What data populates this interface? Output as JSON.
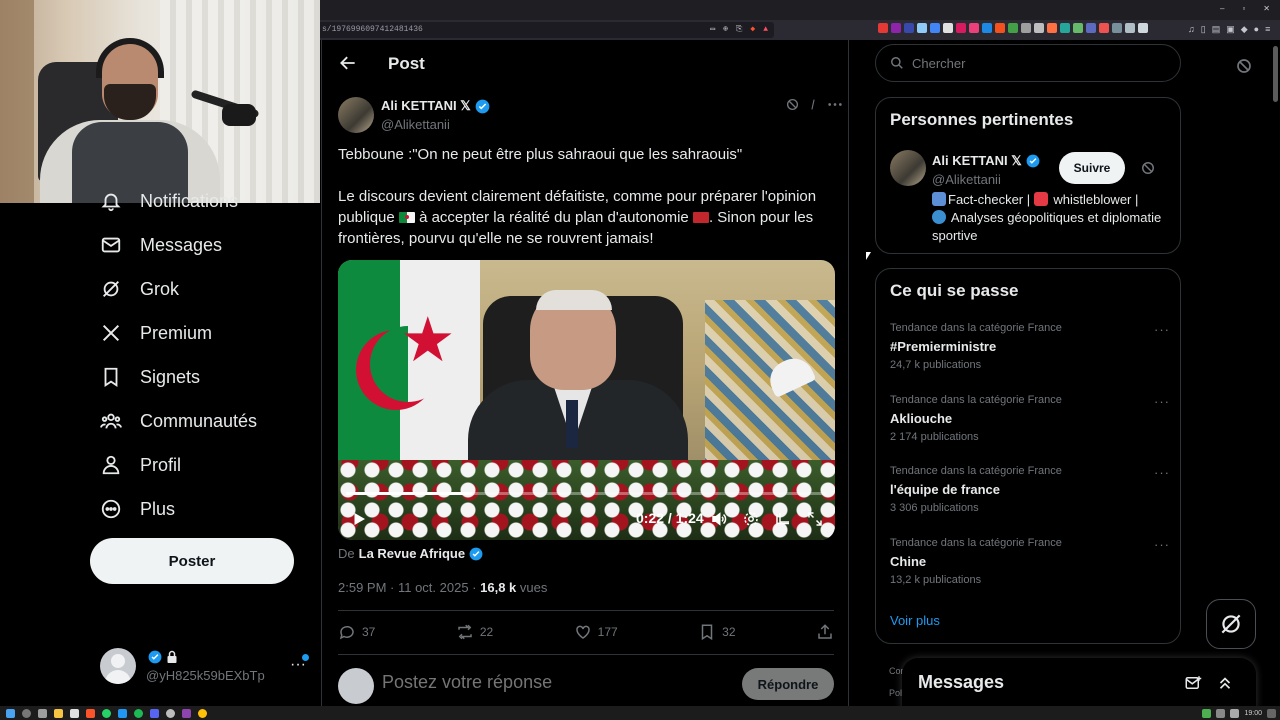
{
  "browser": {
    "url": "s/1976996097412481436",
    "window_controls": [
      "–",
      "▫",
      "✕"
    ]
  },
  "nav": {
    "items": [
      {
        "label": "Notifications",
        "icon": "bell-icon"
      },
      {
        "label": "Messages",
        "icon": "mail-icon"
      },
      {
        "label": "Grok",
        "icon": "grok-icon"
      },
      {
        "label": "Premium",
        "icon": "x-logo-icon"
      },
      {
        "label": "Signets",
        "icon": "bookmark-icon"
      },
      {
        "label": "Communautés",
        "icon": "people-icon"
      },
      {
        "label": "Profil",
        "icon": "user-icon"
      },
      {
        "label": "Plus",
        "icon": "more-circle-icon"
      }
    ],
    "post_button": "Poster",
    "account_handle": "@yH825k59bEXbTp",
    "account_more": "···"
  },
  "post": {
    "header_title": "Post",
    "author_name": "Ali KETTANI 𝕏",
    "author_handle": "@Alikettanii",
    "text_line1": "Tebboune :\"On ne peut être plus sahraoui que les sahraouis\"",
    "text_p2_a": "Le discours devient clairement défaitiste, comme pour préparer l'opinion publique",
    "text_p2_b": "à accepter la réalité du plan d'autonomie",
    "text_p2_c": ". Sinon pour les frontières, pourvu qu'elle ne se rouvrent jamais!",
    "video_time": "0:22 / 1:24",
    "video_progress": 0.262,
    "source_prefix": "De",
    "source_name": "La Revue Afrique",
    "time": "2:59 PM · 11 oct. 2025 · ",
    "views_count": "16,8 k",
    "views_label": " vues",
    "stats": {
      "replies": "37",
      "reposts": "22",
      "likes": "177",
      "bookmarks": "32"
    },
    "reply_placeholder": "Postez votre réponse",
    "reply_button": "Répondre"
  },
  "right": {
    "search_placeholder": "Chercher",
    "people_title": "Personnes pertinentes",
    "person": {
      "name": "Ali KETTANI 𝕏",
      "handle": "@Alikettanii",
      "follow": "Suivre",
      "bio_1": "Fact-checker | ",
      "bio_2": " whistleblower |",
      "bio_3": " Analyses géopolitiques et diplomatie sportive"
    },
    "trends_title": "Ce qui se passe",
    "trends": [
      {
        "category": "Tendance dans la catégorie France",
        "name": "#Premierministre",
        "count": "24,7 k publications"
      },
      {
        "category": "Tendance dans la catégorie France",
        "name": "Akliouche",
        "count": "2 174 publications"
      },
      {
        "category": "Tendance dans la catégorie France",
        "name": "l'équipe de france",
        "count": "3 306 publications"
      },
      {
        "category": "Tendance dans la catégorie France",
        "name": "Chine",
        "count": "13,2 k publications"
      }
    ],
    "see_more": "Voir plus",
    "messages_title": "Messages",
    "footer_1": "Con",
    "footer_2": "Poli"
  },
  "colors": {
    "accent": "#1d9bf0",
    "background": "#000000",
    "border": "#2f3336",
    "muted": "#71767b"
  },
  "taskbar": {
    "clock": "19:00"
  }
}
